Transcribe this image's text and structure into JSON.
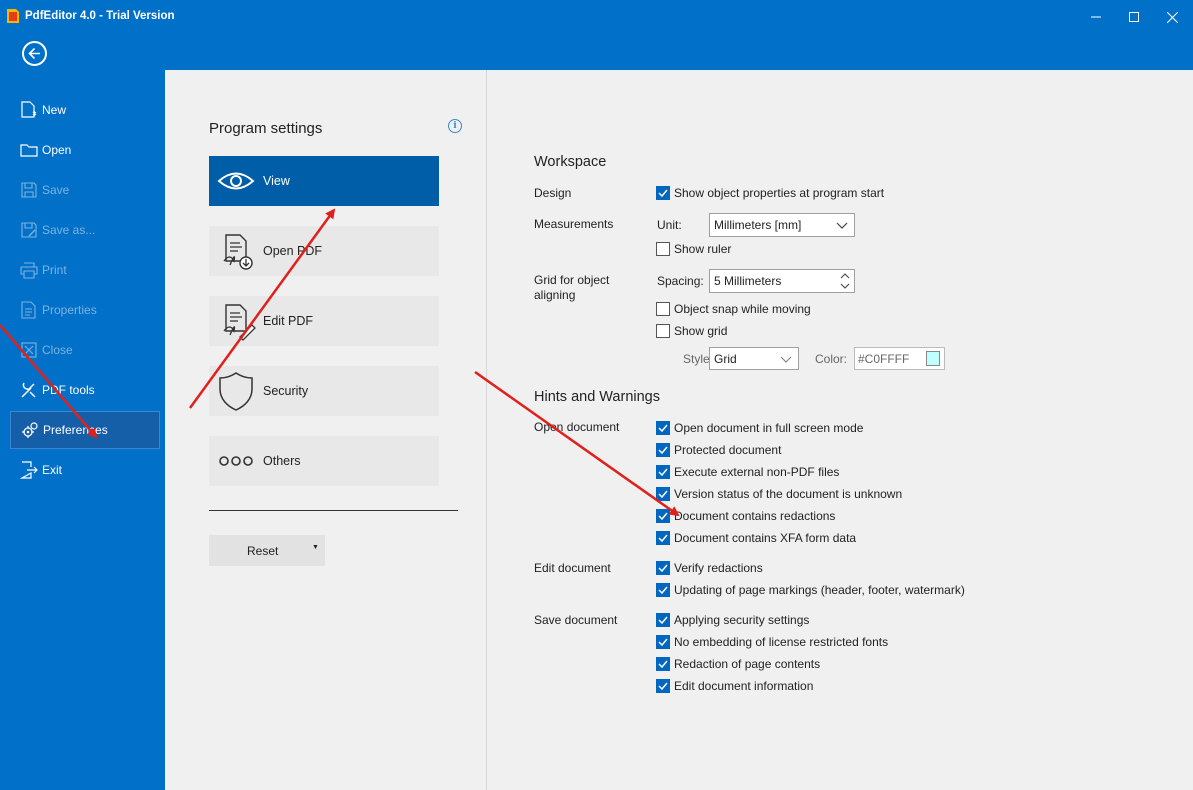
{
  "app": {
    "title": "PdfEditor 4.0 - Trial Version",
    "window_buttons": [
      "minimize-icon",
      "maximize-icon",
      "close-icon"
    ]
  },
  "nav": {
    "back": "back-arrow-icon",
    "items": [
      {
        "label": "New",
        "icon": "new-document-icon",
        "state": "enabled"
      },
      {
        "label": "Open",
        "icon": "folder-icon",
        "state": "enabled"
      },
      {
        "label": "Save",
        "icon": "save-icon",
        "state": "disabled"
      },
      {
        "label": "Save as...",
        "icon": "save-as-icon",
        "state": "disabled"
      },
      {
        "label": "Print",
        "icon": "print-icon",
        "state": "disabled"
      },
      {
        "label": "Properties",
        "icon": "properties-icon",
        "state": "disabled"
      },
      {
        "label": "Close",
        "icon": "close-doc-icon",
        "state": "disabled"
      },
      {
        "label": "PDF tools",
        "icon": "tools-icon",
        "state": "enabled"
      },
      {
        "label": "Preferences",
        "icon": "gears-icon",
        "state": "selected"
      },
      {
        "label": "Exit",
        "icon": "exit-icon",
        "state": "enabled"
      }
    ]
  },
  "settings": {
    "title": "Program settings",
    "info_icon": "info-icon",
    "categories": [
      {
        "label": "View",
        "icon": "eye-icon",
        "active": true
      },
      {
        "label": "Open PDF",
        "icon": "open-pdf-icon",
        "active": false
      },
      {
        "label": "Edit PDF",
        "icon": "edit-pdf-icon",
        "active": false
      },
      {
        "label": "Security",
        "icon": "shield-icon",
        "active": false
      },
      {
        "label": "Others",
        "icon": "dots-icon",
        "active": false
      }
    ],
    "reset_label": "Reset"
  },
  "workspace": {
    "title": "Workspace",
    "design_label": "Design",
    "show_props": {
      "label": "Show object properties at program start",
      "checked": true
    },
    "measurements_label": "Measurements",
    "unit_label": "Unit:",
    "unit_value": "Millimeters [mm]",
    "show_ruler": {
      "label": "Show ruler",
      "checked": false
    },
    "grid_label_1": "Grid for object",
    "grid_label_2": "aligning",
    "spacing_label": "Spacing:",
    "spacing_value": "5 Millimeters",
    "object_snap": {
      "label": "Object snap while moving",
      "checked": false
    },
    "show_grid": {
      "label": "Show grid",
      "checked": false
    },
    "style_label": "Style",
    "style_value": "Grid",
    "color_label": "Color:",
    "color_value": "#C0FFFF",
    "color_swatch": "#c0ffff"
  },
  "hints": {
    "title": "Hints and Warnings",
    "open_doc_label": "Open document",
    "open_doc": [
      {
        "label": "Open document in full screen mode",
        "checked": true
      },
      {
        "label": "Protected document",
        "checked": true
      },
      {
        "label": "Execute external non-PDF files",
        "checked": true
      },
      {
        "label": "Version status of the document is unknown",
        "checked": true
      },
      {
        "label": "Document contains redactions",
        "checked": true
      },
      {
        "label": "Document contains XFA form data",
        "checked": true
      }
    ],
    "edit_doc_label": "Edit document",
    "edit_doc": [
      {
        "label": "Verify redactions",
        "checked": true
      },
      {
        "label": "Updating of page markings (header, footer, watermark)",
        "checked": true
      }
    ],
    "save_doc_label": "Save document",
    "save_doc": [
      {
        "label": "Applying security settings",
        "checked": true
      },
      {
        "label": "No embedding of license restricted fonts",
        "checked": true
      },
      {
        "label": "Redaction of page contents",
        "checked": true
      },
      {
        "label": "Edit document information",
        "checked": true
      }
    ]
  },
  "colors": {
    "frame_blue": "#0070c8",
    "active_category": "#005ea8",
    "checkbox_blue": "#0067c0",
    "annotation_arrow": "#e0201b"
  }
}
